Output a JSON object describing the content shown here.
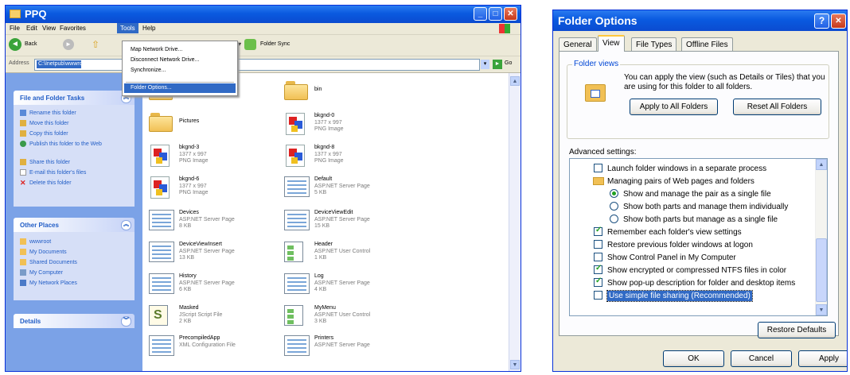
{
  "explorer": {
    "title": "PPQ",
    "menu": [
      "File",
      "Edit",
      "View",
      "Favorites",
      "Tools",
      "Help"
    ],
    "toolbar": {
      "back": "Back",
      "folder_sync": "Folder Sync"
    },
    "address": {
      "label": "Address",
      "value": "C:\\Inetpub\\wwwroot",
      "go": "Go"
    },
    "tools_menu": [
      "Map Network Drive...",
      "Disconnect Network Drive...",
      "Synchronize...",
      "Folder Options..."
    ],
    "tasks_panel": {
      "title": "File and Folder Tasks",
      "items": [
        "Rename this folder",
        "Move this folder",
        "Copy this folder",
        "Publish this folder to the Web",
        "Share this folder",
        "E-mail this folder's files",
        "Delete this folder"
      ]
    },
    "places_panel": {
      "title": "Other Places",
      "items": [
        "wwwroot",
        "My Documents",
        "Shared Documents",
        "My Computer",
        "My Network Places"
      ]
    },
    "details_panel": {
      "title": "Details"
    },
    "files": [
      {
        "name": "App_Data",
        "l1": "",
        "l2": "",
        "kind": "folder"
      },
      {
        "name": "bin",
        "l1": "",
        "l2": "",
        "kind": "folder"
      },
      {
        "name": "Pictures",
        "l1": "",
        "l2": "",
        "kind": "folder"
      },
      {
        "name": "bkgnd-0",
        "l1": "1377 x 997",
        "l2": "PNG Image",
        "kind": "png"
      },
      {
        "name": "bkgnd-3",
        "l1": "1377 x 997",
        "l2": "PNG Image",
        "kind": "png"
      },
      {
        "name": "bkgnd-8",
        "l1": "1377 x 997",
        "l2": "PNG Image",
        "kind": "png"
      },
      {
        "name": "bkgnd-6",
        "l1": "1377 x 997",
        "l2": "PNG Image",
        "kind": "png"
      },
      {
        "name": "Default",
        "l1": "ASP.NET Server Page",
        "l2": "5 KB",
        "kind": "aspx"
      },
      {
        "name": "Devices",
        "l1": "ASP.NET Server Page",
        "l2": "8 KB",
        "kind": "aspx"
      },
      {
        "name": "DeviceViewEdit",
        "l1": "ASP.NET Server Page",
        "l2": "15 KB",
        "kind": "aspx"
      },
      {
        "name": "DeviceViewInsert",
        "l1": "ASP.NET Server Page",
        "l2": "13 KB",
        "kind": "aspx"
      },
      {
        "name": "Header",
        "l1": "ASP.NET User Control",
        "l2": "1 KB",
        "kind": "ascx"
      },
      {
        "name": "History",
        "l1": "ASP.NET Server Page",
        "l2": "6 KB",
        "kind": "aspx"
      },
      {
        "name": "Log",
        "l1": "ASP.NET Server Page",
        "l2": "4 KB",
        "kind": "aspx"
      },
      {
        "name": "Masked",
        "l1": "JScript Script File",
        "l2": "2 KB",
        "kind": "js"
      },
      {
        "name": "MyMenu",
        "l1": "ASP.NET User Control",
        "l2": "3 KB",
        "kind": "ascx"
      },
      {
        "name": "PrecompiledApp",
        "l1": "XML Configuration File",
        "l2": "",
        "kind": "aspx"
      },
      {
        "name": "Printers",
        "l1": "ASP.NET Server Page",
        "l2": "",
        "kind": "aspx"
      }
    ]
  },
  "dialog": {
    "title": "Folder Options",
    "tabs": [
      "General",
      "View",
      "File Types",
      "Offline Files"
    ],
    "folder_views": {
      "legend": "Folder views",
      "text": "You can apply the view (such as Details or Tiles) that you are using for this folder to all folders.",
      "apply_btn": "Apply to All Folders",
      "reset_btn": "Reset All Folders"
    },
    "advanced_label": "Advanced settings:",
    "settings": [
      {
        "type": "checkbox",
        "checked": false,
        "indent": 0,
        "label": "Launch folder windows in a separate process"
      },
      {
        "type": "folder",
        "indent": 0,
        "label": "Managing pairs of Web pages and folders"
      },
      {
        "type": "radio",
        "checked": true,
        "indent": 1,
        "label": "Show and manage the pair as a single file"
      },
      {
        "type": "radio",
        "checked": false,
        "indent": 1,
        "label": "Show both parts and manage them individually"
      },
      {
        "type": "radio",
        "checked": false,
        "indent": 1,
        "label": "Show both parts but manage as a single file"
      },
      {
        "type": "checkbox",
        "checked": true,
        "indent": 0,
        "label": "Remember each folder's view settings"
      },
      {
        "type": "checkbox",
        "checked": false,
        "indent": 0,
        "label": "Restore previous folder windows at logon"
      },
      {
        "type": "checkbox",
        "checked": false,
        "indent": 0,
        "label": "Show Control Panel in My Computer"
      },
      {
        "type": "checkbox",
        "checked": true,
        "indent": 0,
        "label": "Show encrypted or compressed NTFS files in color"
      },
      {
        "type": "checkbox",
        "checked": true,
        "indent": 0,
        "label": "Show pop-up description for folder and desktop items"
      },
      {
        "type": "checkbox",
        "checked": false,
        "indent": 0,
        "label": "Use simple file sharing (Recommended)",
        "selected": true
      }
    ],
    "restore_btn": "Restore Defaults",
    "ok_btn": "OK",
    "cancel_btn": "Cancel",
    "apply_btn": "Apply"
  }
}
